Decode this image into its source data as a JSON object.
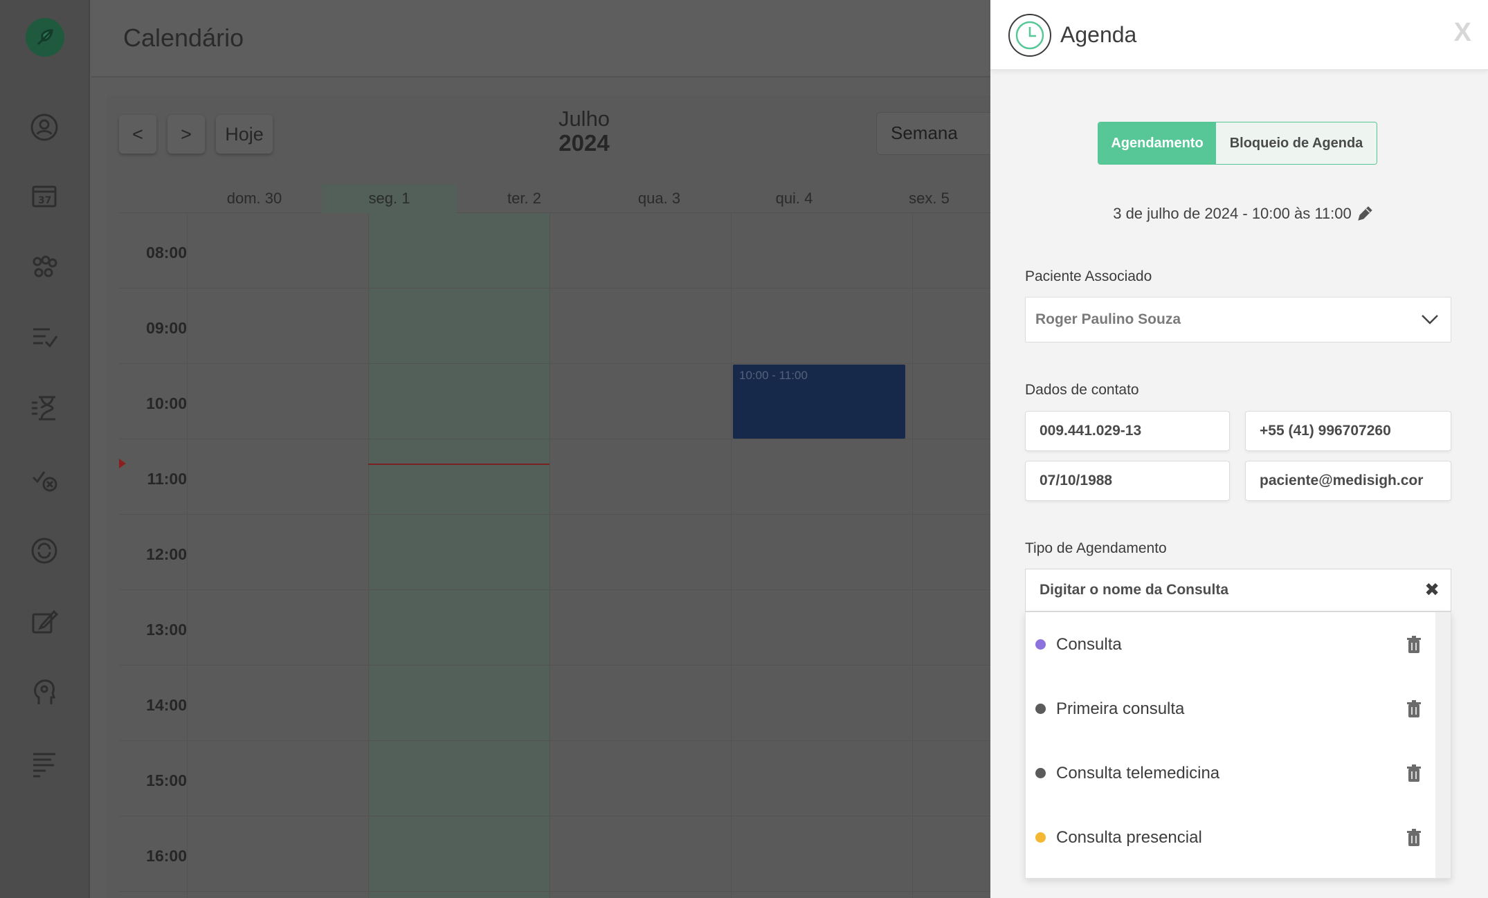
{
  "page": {
    "title": "Calendário"
  },
  "sidebar": {
    "icons": [
      "logo-icon",
      "profile-icon",
      "calendar-icon",
      "group-icon",
      "checklist-icon",
      "hourglass-icon",
      "check-x-icon",
      "sync-icon",
      "edit-note-icon",
      "head-icon",
      "menu-lines-icon"
    ],
    "calendar_badge": "37"
  },
  "calendar": {
    "prev_label": "<",
    "next_label": ">",
    "today_label": "Hoje",
    "month": "Julho",
    "year": "2024",
    "view": "Semana",
    "days": [
      "dom. 30",
      "seg. 1",
      "ter. 2",
      "qua. 3",
      "qui. 4",
      "sex. 5"
    ],
    "hours": [
      "08:00",
      "09:00",
      "10:00",
      "11:00",
      "12:00",
      "13:00",
      "14:00",
      "15:00",
      "16:00"
    ],
    "event": {
      "time": "10:00 - 11:00",
      "color": "#17294a"
    }
  },
  "drawer": {
    "title": "Agenda",
    "close": "X",
    "tabs": {
      "active": "Agendamento",
      "inactive": "Bloqueio de Agenda"
    },
    "date_range": "3 de julho de 2024 - 10:00 às 11:00",
    "patient": {
      "label": "Paciente Associado",
      "value": "Roger Paulino Souza"
    },
    "contact": {
      "label": "Dados de contato",
      "cpf": "009.441.029-13",
      "phone": "+55 (41) 996707260",
      "birth": "07/10/1988",
      "email": "paciente@medisigh.cor"
    },
    "appointment_type": {
      "label": "Tipo de Agendamento",
      "placeholder": "Digitar o nome da Consulta",
      "clear": "✖",
      "options": [
        {
          "label": "Consulta",
          "color": "#8b72dc"
        },
        {
          "label": "Primeira consulta",
          "color": "#5b5b5b"
        },
        {
          "label": "Consulta telemedicina",
          "color": "#5b5b5b"
        },
        {
          "label": "Consulta presencial",
          "color": "#f3b731"
        }
      ]
    },
    "accent": "#58c797"
  }
}
